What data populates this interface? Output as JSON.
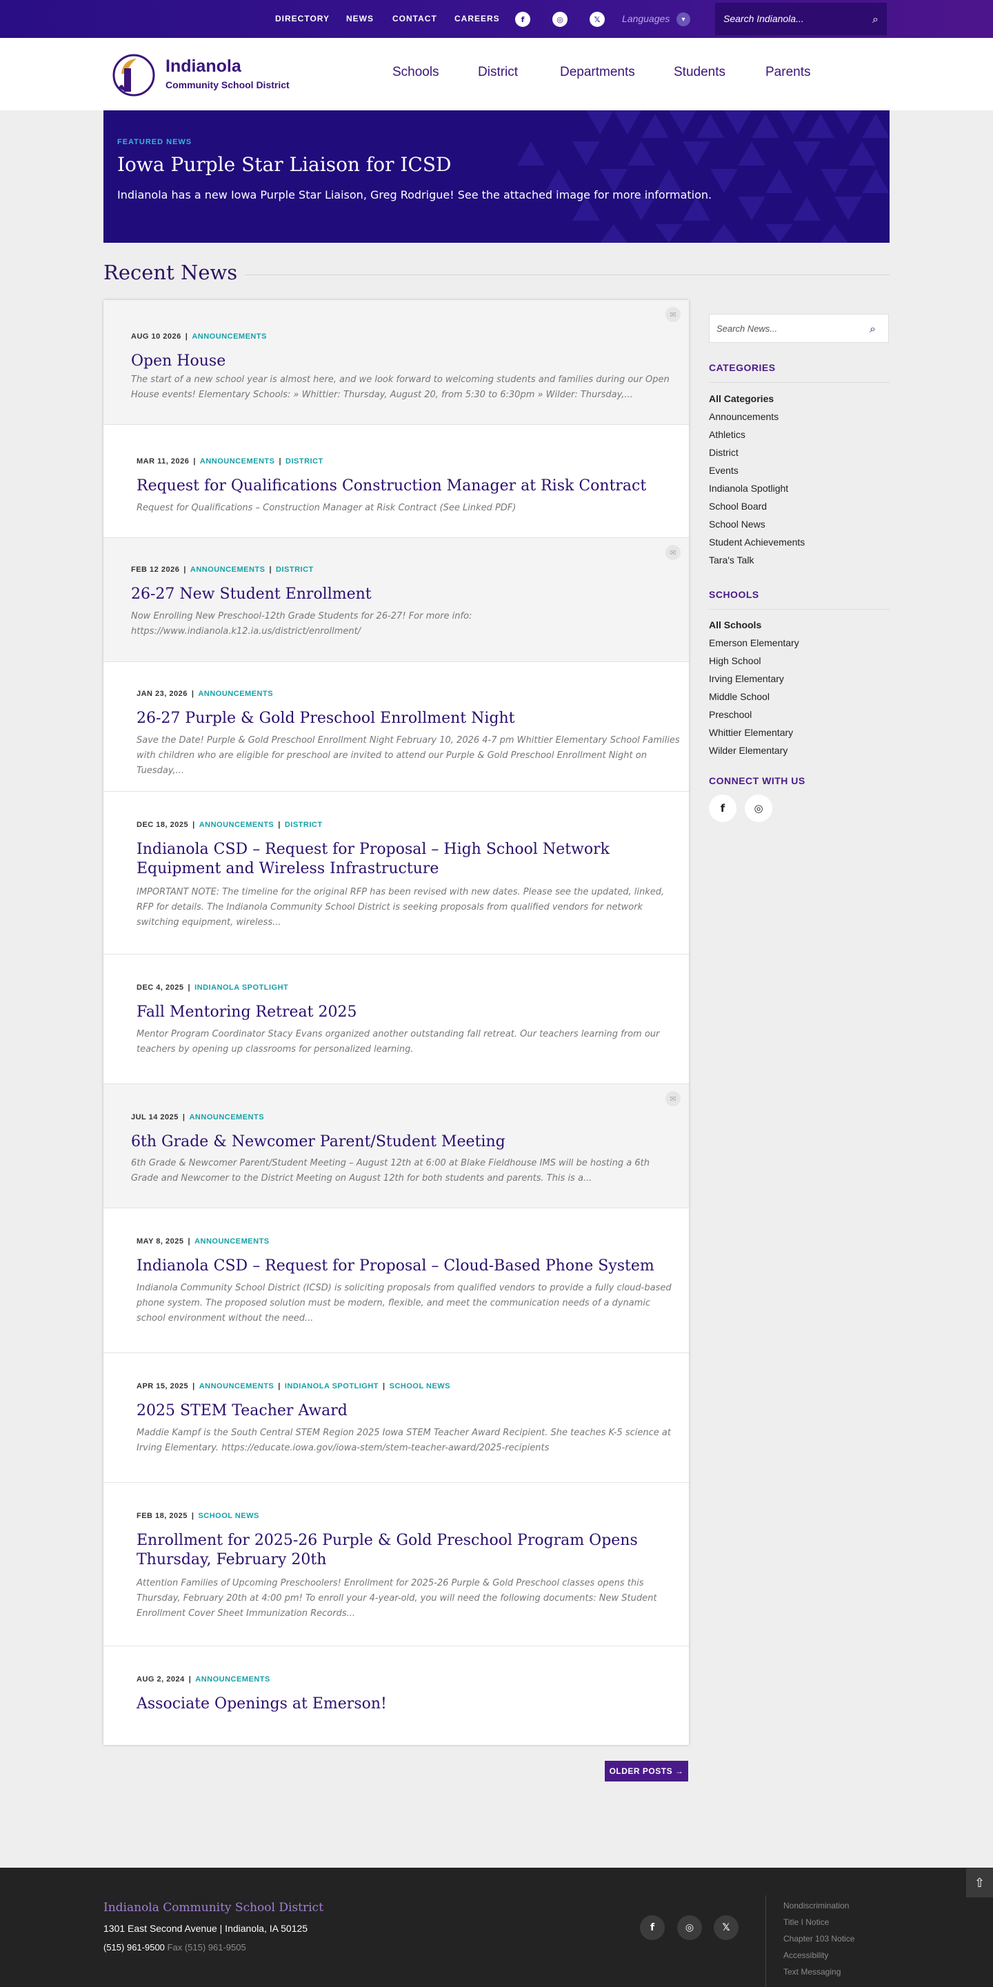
{
  "topbar": {
    "links": [
      "DIRECTORY",
      "NEWS",
      "CONTACT",
      "CAREERS"
    ],
    "languages_label": "Languages",
    "search_placeholder": "Search Indianola..."
  },
  "header": {
    "brand_line1": "Indianola",
    "brand_line2": "Community School District",
    "nav": [
      "Schools",
      "District",
      "Departments",
      "Students",
      "Parents"
    ]
  },
  "hero": {
    "label": "FEATURED NEWS",
    "title": "Iowa Purple Star Liaison for ICSD",
    "description": "Indianola has a new Iowa Purple Star Liaison, Greg Rodrigue!  See the attached image for more information."
  },
  "recent_news_heading": "Recent News",
  "posts": [
    {
      "date": "AUG 10 2026",
      "cats": [
        "ANNOUNCEMENTS"
      ],
      "title": "Open House",
      "excerpt": "The start of a new school year is almost here, and we look forward to welcoming students and families during our Open House events! Elementary Schools: » Whittier: Thursday, August 20, from 5:30 to 6:30pm » Wilder: Thursday,...",
      "featured": true
    },
    {
      "date": "MAR 11, 2026",
      "cats": [
        "ANNOUNCEMENTS",
        "DISTRICT"
      ],
      "title": "Request for Qualifications Construction Manager at Risk Contract",
      "excerpt": "Request for Qualifications – Construction Manager at Risk Contract (See Linked PDF)",
      "featured": false
    },
    {
      "date": "FEB 12 2026",
      "cats": [
        "ANNOUNCEMENTS",
        "DISTRICT"
      ],
      "title": "26-27 New Student Enrollment",
      "excerpt": "Now Enrolling New Preschool-12th Grade Students for 26-27! For more info: https://www.indianola.k12.ia.us/district/enrollment/",
      "featured": true
    },
    {
      "date": "JAN 23, 2026",
      "cats": [
        "ANNOUNCEMENTS"
      ],
      "title": "26-27 Purple & Gold Preschool Enrollment Night",
      "excerpt": "Save the Date! Purple & Gold Preschool Enrollment Night February 10, 2026 4-7 pm Whittier Elementary School Families with children who are eligible for preschool are invited to attend our Purple & Gold Preschool Enrollment Night on Tuesday,...",
      "featured": false
    },
    {
      "date": "DEC 18, 2025",
      "cats": [
        "ANNOUNCEMENTS",
        "DISTRICT"
      ],
      "title": "Indianola CSD – Request for Proposal – High School Network Equipment and Wireless Infrastructure",
      "excerpt": "IMPORTANT NOTE: The timeline for the original RFP has been revised with new dates.  Please see the updated, linked, RFP for details. The Indianola Community School District is seeking proposals from qualified vendors for network switching equipment, wireless...",
      "featured": false
    },
    {
      "date": "DEC 4, 2025",
      "cats": [
        "INDIANOLA SPOTLIGHT"
      ],
      "title": "Fall Mentoring Retreat 2025",
      "excerpt": "Mentor Program Coordinator Stacy Evans organized another outstanding fall retreat. Our teachers learning from our teachers by opening up classrooms for personalized learning.",
      "featured": false
    },
    {
      "date": "JUL 14 2025",
      "cats": [
        "ANNOUNCEMENTS"
      ],
      "title": "6th Grade & Newcomer Parent/Student Meeting",
      "excerpt": "6th Grade & Newcomer Parent/Student Meeting – August 12th at 6:00 at Blake Fieldhouse IMS will be hosting a 6th Grade and Newcomer to the District Meeting on August 12th for both students and parents. This is a...",
      "featured": true
    },
    {
      "date": "MAY 8, 2025",
      "cats": [
        "ANNOUNCEMENTS"
      ],
      "title": "Indianola CSD – Request for Proposal – Cloud-Based Phone System",
      "excerpt": "Indianola Community School District (ICSD) is soliciting proposals from qualified vendors to provide a fully cloud-based phone system. The proposed solution must be modern, flexible, and meet the communication needs of a dynamic school environment without the need...",
      "featured": false
    },
    {
      "date": "APR 15, 2025",
      "cats": [
        "ANNOUNCEMENTS",
        "INDIANOLA SPOTLIGHT",
        "SCHOOL NEWS"
      ],
      "title": "2025 STEM Teacher Award",
      "excerpt": "Maddie Kampf is the South Central STEM Region 2025 Iowa STEM Teacher Award Recipient. She teaches K-5 science at Irving Elementary. https://educate.iowa.gov/iowa-stem/stem-teacher-award/2025-recipients",
      "featured": false
    },
    {
      "date": "FEB 18, 2025",
      "cats": [
        "SCHOOL NEWS"
      ],
      "title": "Enrollment for 2025-26 Purple & Gold Preschool Program Opens Thursday, February 20th",
      "excerpt": "Attention Families of Upcoming Preschoolers! Enrollment for 2025-26 Purple & Gold Preschool classes opens this Thursday, February 20th at 4:00 pm! To enroll your 4-year-old, you will need the following documents: New Student Enrollment Cover Sheet Immunization Records...",
      "featured": false
    },
    {
      "date": "AUG 2, 2024",
      "cats": [
        "ANNOUNCEMENTS"
      ],
      "title": "Associate Openings at Emerson!",
      "excerpt": "",
      "featured": false
    }
  ],
  "older_posts_label": "OLDER POSTS →",
  "sidebar": {
    "search_placeholder": "Search News...",
    "categories_heading": "CATEGORIES",
    "categories": [
      "All Categories",
      "Announcements",
      "Athletics",
      "District",
      "Events",
      "Indianola Spotlight",
      "School Board",
      "School News",
      "Student Achievements",
      "Tara's Talk"
    ],
    "schools_heading": "SCHOOLS",
    "schools": [
      "All Schools",
      "Emerson Elementary",
      "High School",
      "Irving Elementary",
      "Middle School",
      "Preschool",
      "Whittier Elementary",
      "Wilder Elementary"
    ],
    "connect_heading": "CONNECT WITH US"
  },
  "footer": {
    "name": "Indianola Community School District",
    "address": "1301 East Second Avenue  |  Indianola, IA 50125",
    "phone": "(515) 961-9500",
    "fax": "Fax (515) 961-9505",
    "links": [
      "Nondiscrimination",
      "Title I Notice",
      "Chapter 103 Notice",
      "Accessibility",
      "Text Messaging"
    ]
  },
  "colors": {
    "brand_purple": "#3a157a",
    "accent_teal": "#16a0a8",
    "hero_bg": "#210c7c",
    "footer_bg": "#232323"
  }
}
